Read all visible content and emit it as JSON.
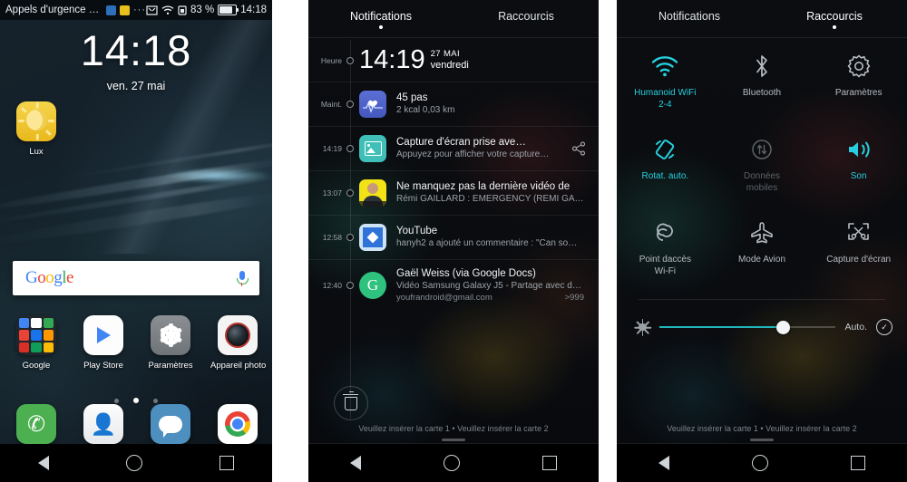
{
  "panel1": {
    "status_bar": {
      "carrier": "Appels d'urgence uni…",
      "overflow": "···",
      "battery_percent": "83 %",
      "clock": "14:18"
    },
    "lockclock": {
      "time": "14:18",
      "date": "ven. 27 mai"
    },
    "apps": [
      {
        "label": "Lux",
        "icon": "lux-icon"
      }
    ],
    "search": {
      "logo": "Google",
      "mic": "microphone-icon"
    },
    "dock_row": [
      {
        "label": "Google",
        "icon": "google-folder-icon"
      },
      {
        "label": "Play Store",
        "icon": "play-store-icon"
      },
      {
        "label": "Paramètres",
        "icon": "settings-gear-icon"
      },
      {
        "label": "Appareil photo",
        "icon": "camera-icon"
      }
    ],
    "dock": [
      {
        "label": "Phone",
        "icon": "phone-icon"
      },
      {
        "label": "Contacts",
        "icon": "contacts-icon"
      },
      {
        "label": "Messages",
        "icon": "messages-icon"
      },
      {
        "label": "Chrome",
        "icon": "chrome-icon"
      }
    ],
    "page_dots": 3,
    "active_dot": 1,
    "nav": [
      "back-icon",
      "home-icon",
      "recents-icon"
    ]
  },
  "panel2": {
    "tabs": {
      "notifications": "Notifications",
      "shortcuts": "Raccourcis",
      "active": "notifications"
    },
    "labels": {
      "heure": "Heure",
      "maintenant": "Maint."
    },
    "clock": {
      "time": "14:19",
      "date_line1": "27 MAI",
      "date_line2": "vendredi"
    },
    "notifications": [
      {
        "time": "Maint.",
        "icon": "health-heart-icon",
        "title": "45 pas",
        "sub": "2 kcal     0,03 km"
      },
      {
        "time": "14:19",
        "icon": "screenshot-photo-icon",
        "title": "Capture d'écran prise ave…",
        "sub": "Appuyez pour afficher votre capture…",
        "action_icon": "share-icon"
      },
      {
        "time": "13:07",
        "icon": "remi-gaillard-avatar",
        "title": "Ne manquez pas la dernière vidéo de",
        "sub": "Rémi GAILLARD : EMERGENCY (REMI GAIL…"
      },
      {
        "time": "12:58",
        "icon": "youtube-icon",
        "title": "YouTube",
        "sub": "hanyh2 a ajouté un commentaire : \"Can so…"
      },
      {
        "time": "12:40",
        "icon": "gmail-avatar-g",
        "avatar_letter": "G",
        "title": "Gaël Weiss (via Google Docs)",
        "sub": "Vidéo Samsung Galaxy J5 - Partage avec d…",
        "account": "youfrandroid@gmail.com",
        "count": ">999"
      }
    ],
    "clear_button": "trash-icon",
    "sim_text": "Veuillez insérer la carte 1 • Veuillez insérer la carte 2"
  },
  "panel3": {
    "tabs": {
      "notifications": "Notifications",
      "shortcuts": "Raccourcis",
      "active": "shortcuts"
    },
    "tiles": [
      {
        "label": "Humanoid WiFi\n2-4",
        "icon": "wifi-icon",
        "state": "on"
      },
      {
        "label": "Bluetooth",
        "icon": "bluetooth-icon",
        "state": "default"
      },
      {
        "label": "Paramètres",
        "icon": "settings-gear-icon",
        "state": "default"
      },
      {
        "label": "Rotat. auto.",
        "icon": "auto-rotate-icon",
        "state": "on"
      },
      {
        "label": "Données\nmobiles",
        "icon": "mobile-data-icon",
        "state": "off"
      },
      {
        "label": "Son",
        "icon": "sound-icon",
        "state": "on"
      },
      {
        "label": "Point daccès\nWi-Fi",
        "icon": "hotspot-icon",
        "state": "default"
      },
      {
        "label": "Mode Avion",
        "icon": "airplane-icon",
        "state": "default"
      },
      {
        "label": "Capture d'écran",
        "icon": "screenshot-icon",
        "state": "default"
      }
    ],
    "brightness": {
      "icon": "brightness-sun-icon",
      "value_percent": 70,
      "auto_label": "Auto.",
      "auto_checked": true
    },
    "sim_text": "Veuillez insérer la carte 1 • Veuillez insérer la carte 2"
  },
  "colors": {
    "accent": "#27d0e0",
    "slider": "#21b5bd",
    "dim": "#5d6368"
  }
}
